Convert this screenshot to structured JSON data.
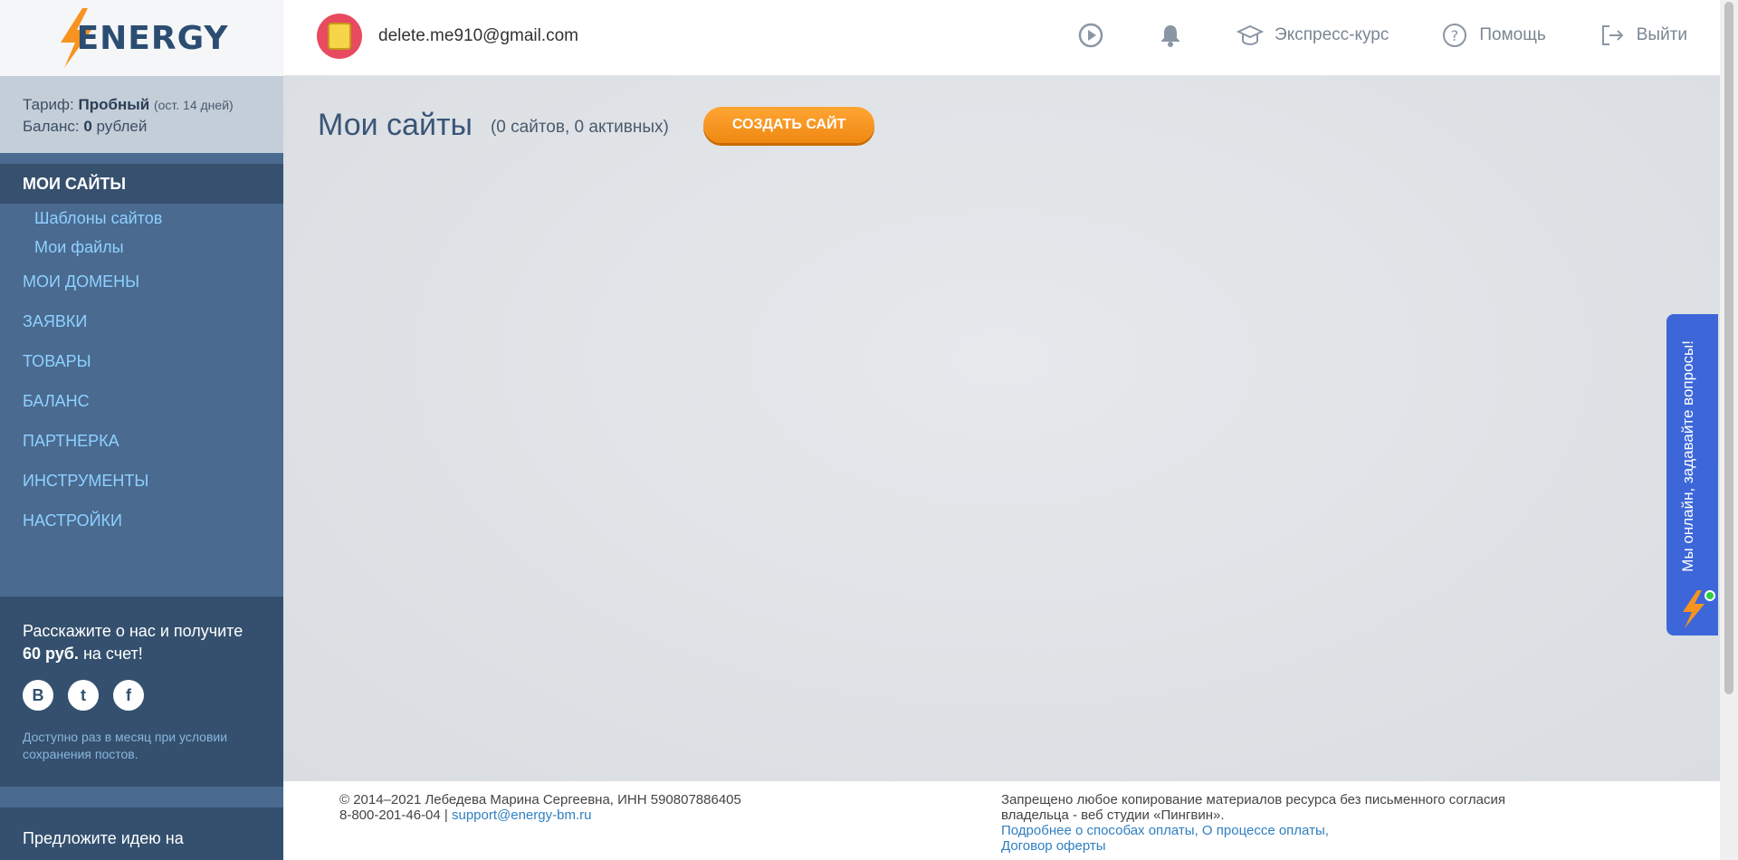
{
  "brand": {
    "name": "ENERGY"
  },
  "user": {
    "email": "delete.me910@gmail.com"
  },
  "topbar": {
    "express_label": "Экспресс-курс",
    "help_label": "Помощь",
    "logout_label": "Выйти"
  },
  "tariff": {
    "label": "Тариф:",
    "plan": "Пробный",
    "remaining": "(ост. 14 дней)",
    "balance_label": "Баланс:",
    "balance_value": "0",
    "balance_unit": "рублей"
  },
  "sidebar": {
    "items": [
      {
        "label": "МОИ САЙТЫ"
      },
      {
        "label": "Шаблоны сайтов"
      },
      {
        "label": "Мои файлы"
      },
      {
        "label": "МОИ ДОМЕНЫ"
      },
      {
        "label": "ЗАЯВКИ"
      },
      {
        "label": "ТОВАРЫ"
      },
      {
        "label": "БАЛАНС"
      },
      {
        "label": "ПАРТНЕРКА"
      },
      {
        "label": "ИНСТРУМЕНТЫ"
      },
      {
        "label": "НАСТРОЙКИ"
      }
    ]
  },
  "promo": {
    "title_pre": "Расскажите о нас и получите",
    "amount": "60 руб.",
    "title_post": "на счет!",
    "social": [
      "В",
      "t",
      "f"
    ],
    "note": "Доступно раз в месяц при условии сохранения постов."
  },
  "idea": {
    "title": "Предложите идею на"
  },
  "main": {
    "title": "Мои сайты",
    "count": "(0 сайтов, 0 активных)",
    "create_label": "СОЗДАТЬ САЙТ"
  },
  "footer": {
    "copyright": "© 2014–2021 Лебедева Марина Сергеевна, ИНН 590807886405",
    "phone": "8-800-201-46-04 |",
    "support_email": "support@energy-bm.ru",
    "notice": "Запрещено любое копирование материалов ресурса без письменного согласия владельца - веб студии «Пингвин».",
    "payment_link": "Подробнее о способах оплаты,",
    "process_link": "О процессе оплаты,",
    "offer_link": "Договор оферты"
  },
  "chat": {
    "label": "Мы онлайн, задавайте вопросы!"
  },
  "colors": {
    "sidebar": "#4a6a90",
    "accent": "#f08812",
    "link": "#8ed1ff",
    "chat": "#3d67d8"
  }
}
